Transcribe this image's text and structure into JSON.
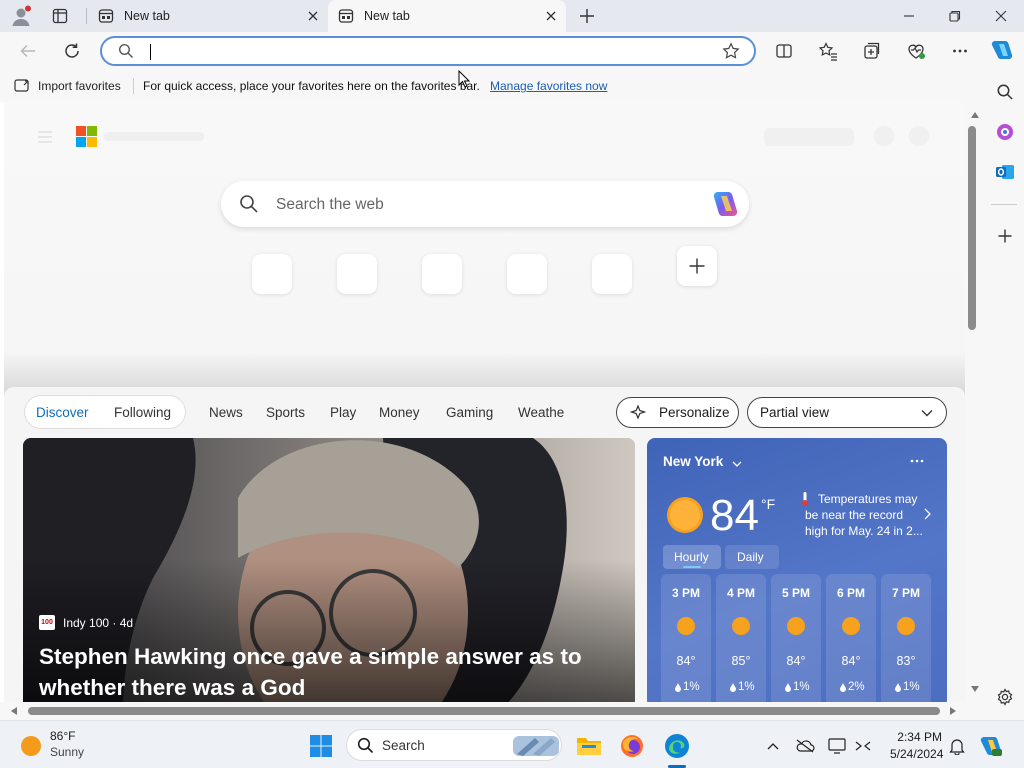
{
  "browser": {
    "tabs": [
      {
        "label": "New tab",
        "active": false
      },
      {
        "label": "New tab",
        "active": true
      }
    ],
    "address": {
      "value": "",
      "placeholder": ""
    }
  },
  "favorites_bar": {
    "import_label": "Import favorites",
    "hint": "For quick access, place your favorites here on the favorites bar.",
    "manage_link": "Manage favorites now"
  },
  "newtab": {
    "search_placeholder": "Search the web",
    "feed_tabs": [
      "Discover",
      "Following",
      "News",
      "Sports",
      "Play",
      "Money",
      "Gaming",
      "Weathe"
    ],
    "personalize_label": "Personalize",
    "view_select": "Partial view"
  },
  "hero": {
    "source": "Indy 100 · 4d",
    "source_logo": "100",
    "headline_line1": "Stephen Hawking once gave a simple answer as to",
    "headline_line2": "whether there was a God"
  },
  "weather": {
    "location": "New York",
    "temp": "84",
    "unit": "°F",
    "alert": "Temperatures may be near the record high for May. 24 in 2...",
    "tabs": [
      "Hourly",
      "Daily"
    ],
    "hourly": [
      {
        "time": "3 PM",
        "temp": "84°",
        "precip": "1%"
      },
      {
        "time": "4 PM",
        "temp": "85°",
        "precip": "1%"
      },
      {
        "time": "5 PM",
        "temp": "84°",
        "precip": "1%"
      },
      {
        "time": "6 PM",
        "temp": "84°",
        "precip": "2%"
      },
      {
        "time": "7 PM",
        "temp": "83°",
        "precip": "1%"
      }
    ]
  },
  "taskbar": {
    "weather_temp": "86°F",
    "weather_cond": "Sunny",
    "search_label": "Search",
    "time": "2:34 PM",
    "date": "5/24/2024"
  },
  "colors": {
    "accent": "#0f6cbd",
    "link": "#1a5fb4",
    "weather_bg": "#4a6cc0"
  }
}
